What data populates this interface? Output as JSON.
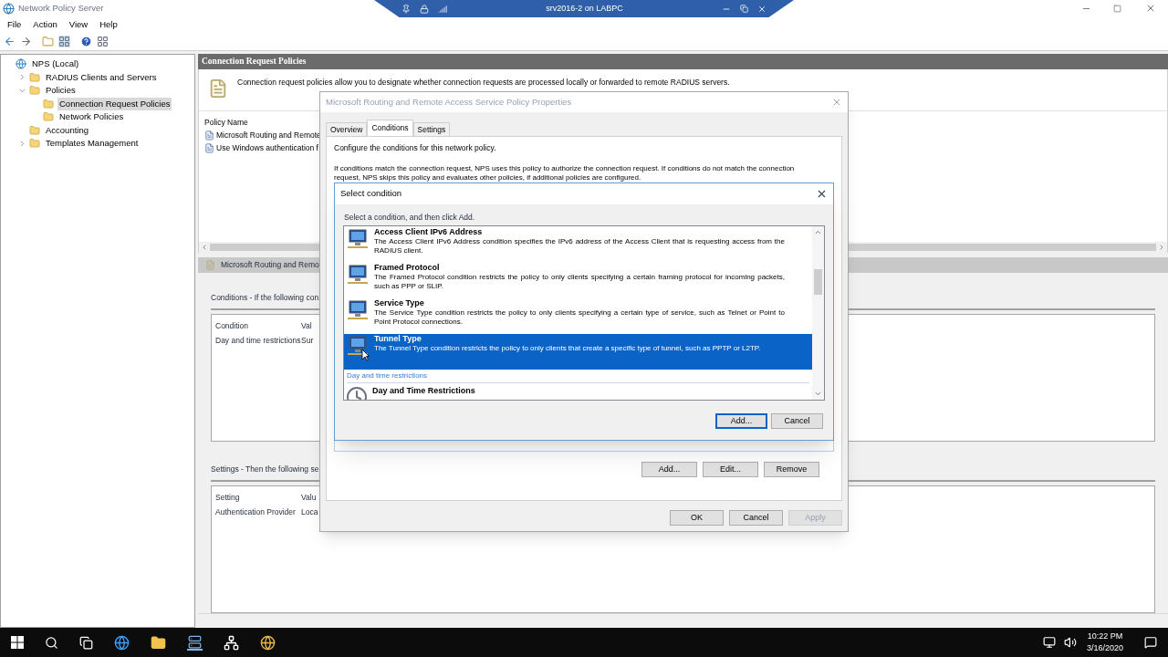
{
  "window": {
    "title": "Network Policy Server"
  },
  "remote_bar": {
    "title": "srv2016-2 on LABPC"
  },
  "menu": [
    "File",
    "Action",
    "View",
    "Help"
  ],
  "tree": [
    {
      "label": "NPS (Local)",
      "selected": false,
      "children": [
        {
          "label": "RADIUS Clients and Servers",
          "selected": false,
          "expanded": false
        },
        {
          "label": "Policies",
          "selected": false,
          "expanded": true,
          "children": [
            {
              "label": "Connection Request Policies",
              "selected": true
            },
            {
              "label": "Network Policies",
              "selected": false
            }
          ]
        },
        {
          "label": "Accounting",
          "selected": false
        },
        {
          "label": "Templates Management",
          "selected": false,
          "expanded": false
        }
      ]
    }
  ],
  "panel": {
    "title": "Connection Request Policies",
    "description": "Connection request policies allow you to designate whether connection requests are processed locally or forwarded to remote RADIUS servers.",
    "policy_list": {
      "columns": [
        "Policy Name"
      ],
      "rows": [
        "Microsoft Routing and Remote",
        "Use Windows authentication f"
      ]
    },
    "detail": {
      "title": "Microsoft Routing and Remo",
      "conditions": {
        "label": "Conditions - If the following con",
        "columns": [
          "Condition",
          "Val"
        ],
        "rows": [
          [
            "Day and time restrictions",
            "Sur"
          ]
        ]
      },
      "settings": {
        "label": "Settings - Then the following se",
        "columns": [
          "Setting",
          "Valu"
        ],
        "rows": [
          [
            "Authentication Provider",
            "Loca"
          ]
        ]
      }
    }
  },
  "properties_dialog": {
    "title": "Microsoft Routing and Remote Access Service Policy Properties",
    "tabs": [
      {
        "label": "Overview",
        "selected": false
      },
      {
        "label": "Conditions",
        "selected": true
      },
      {
        "label": "Settings",
        "selected": false
      }
    ],
    "intro": "Configure the conditions for this network policy.",
    "explanation": "If conditions match the connection request, NPS uses this policy to authorize the connection request. If conditions do not match the connection request, NPS skips this policy and evaluates other policies, if additional policies are configured.",
    "buttons": [
      {
        "label": "Add...",
        "disabled": false
      },
      {
        "label": "Edit...",
        "disabled": false
      },
      {
        "label": "Remove",
        "disabled": false
      }
    ],
    "footer_buttons": [
      {
        "label": "OK",
        "disabled": false
      },
      {
        "label": "Cancel",
        "disabled": false
      },
      {
        "label": "Apply",
        "disabled": true
      }
    ]
  },
  "select_dialog": {
    "title": "Select condition",
    "prompt": "Select a condition, and then click Add.",
    "items": [
      {
        "kind": "condition",
        "title": "Access Client IPv6 Address",
        "description": "The Access Client IPv6 Address condition specifies the IPv6 address of the Access Client that is requesting access from the RADIUS client.",
        "selected": false
      },
      {
        "kind": "condition",
        "title": "Framed Protocol",
        "description": "The Framed Protocol condition restricts the policy to only clients specifying a certain framing protocol for incoming packets, such as PPP or SLIP.",
        "selected": false
      },
      {
        "kind": "condition",
        "title": "Service Type",
        "description": "The Service Type condition restricts the policy to only clients specifying a certain type of service, such as Telnet or Point to Point Protocol connections.",
        "selected": false
      },
      {
        "kind": "condition",
        "title": "Tunnel Type",
        "description": "The Tunnel Type condition restricts the policy to only clients that create a specific type of tunnel, such as PPTP or L2TP.",
        "selected": true
      },
      {
        "kind": "group",
        "label": "Day and time restrictions"
      },
      {
        "kind": "condition",
        "title": "Day and Time Restrictions",
        "selected": false
      }
    ],
    "buttons": [
      {
        "label": "Add...",
        "focused": true
      },
      {
        "label": "Cancel",
        "focused": false
      }
    ]
  },
  "clock": {
    "time": "10:22 PM",
    "date": "3/16/2020"
  }
}
